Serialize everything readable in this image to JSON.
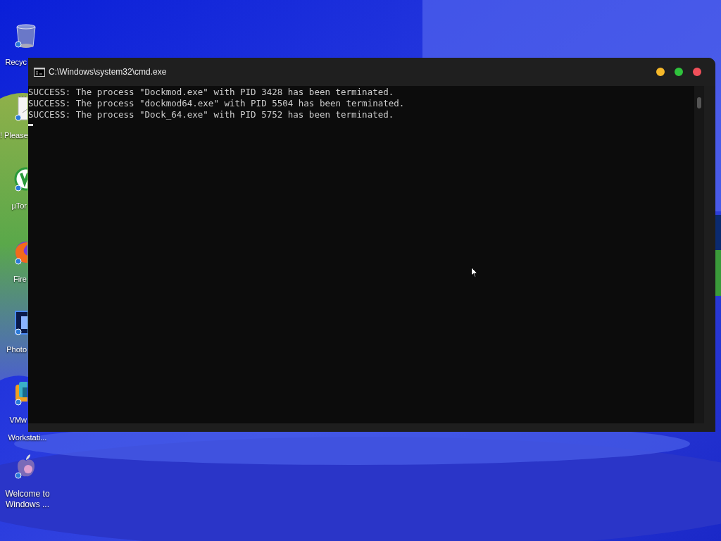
{
  "desktop": {
    "icons": [
      {
        "kind": "bin",
        "label": "Recyc"
      },
      {
        "kind": "note",
        "label": "! Please"
      },
      {
        "kind": "torrent",
        "label": "µTor"
      },
      {
        "kind": "fox",
        "label": "Fire"
      },
      {
        "kind": "ps",
        "label": "Photo"
      },
      {
        "kind": "vm",
        "label": "VMw\nWorkstati..."
      },
      {
        "kind": "apple",
        "label": "Welcome to\nWindows ..."
      }
    ]
  },
  "window": {
    "title": "C:\\Windows\\system32\\cmd.exe",
    "controls": [
      {
        "color": "#f5b82a"
      },
      {
        "color": "#2fc23c"
      },
      {
        "color": "#f0505a"
      }
    ],
    "lines": [
      "SUCCESS: The process \"Dockmod.exe\" with PID 3428 has been terminated.",
      "SUCCESS: The process \"dockmod64.exe\" with PID 5504 has been terminated.",
      "SUCCESS: The process \"Dock_64.exe\" with PID 5752 has been terminated."
    ]
  }
}
